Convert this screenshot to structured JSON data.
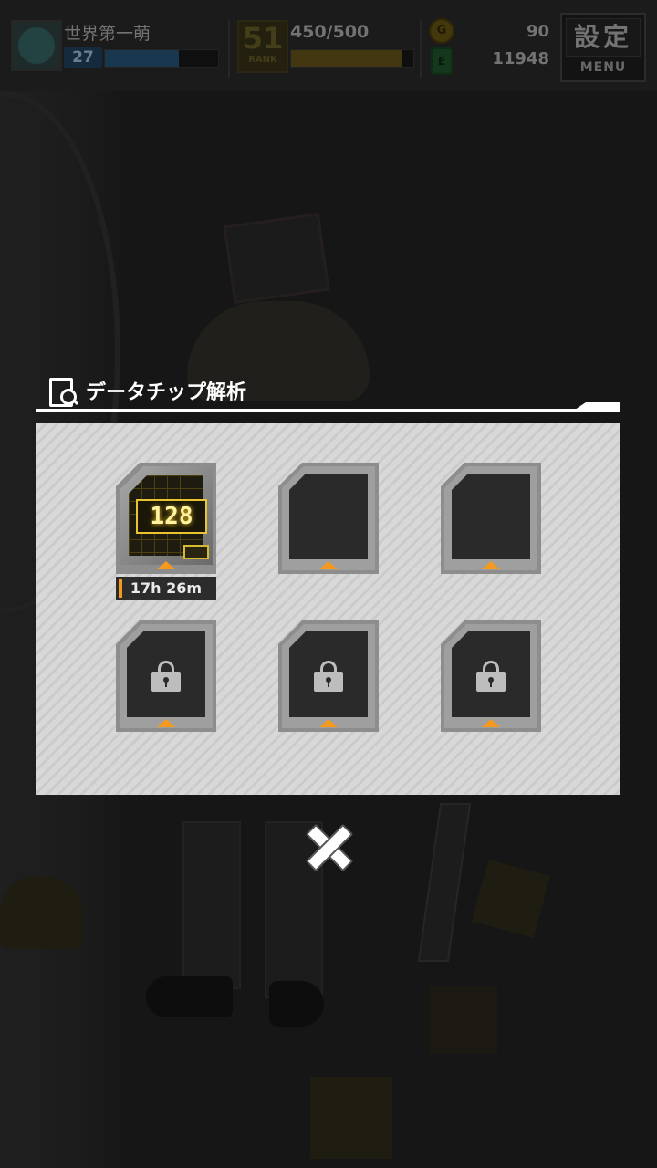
{
  "hud": {
    "player_name": "世界第一萌",
    "level": "27",
    "exp_fraction": 0.65,
    "rank": "51",
    "rank_label": "RANK",
    "stamina": "450/500",
    "stamina_fraction": 0.9,
    "coin_symbol": "G",
    "cash_symbol": "E",
    "coins": "90",
    "cash": "11948",
    "menu_kanji": "設定",
    "menu_label": "MENU"
  },
  "modal": {
    "title": "データチップ解析",
    "slots": [
      {
        "state": "analyzing",
        "chip_number": "128",
        "timer": "17h 26m"
      },
      {
        "state": "empty"
      },
      {
        "state": "empty"
      },
      {
        "state": "locked"
      },
      {
        "state": "locked"
      },
      {
        "state": "locked"
      }
    ],
    "close_symbol": "close-icon"
  },
  "colors": {
    "accent_orange": "#f59a1c",
    "panel_bg": "#d8d8d8",
    "chip_gold": "#e8c430"
  }
}
